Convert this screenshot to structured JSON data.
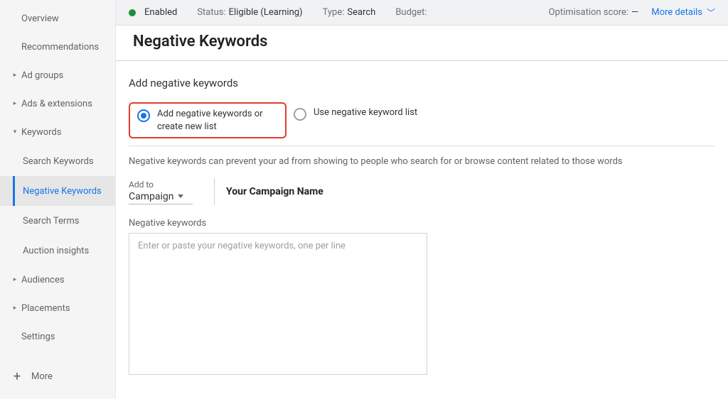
{
  "sidebar": {
    "items": [
      {
        "label": "Overview",
        "expandable": false
      },
      {
        "label": "Recommendations",
        "expandable": false
      },
      {
        "label": "Ad groups",
        "expandable": true,
        "expanded": false
      },
      {
        "label": "Ads & extensions",
        "expandable": true,
        "expanded": false
      },
      {
        "label": "Keywords",
        "expandable": true,
        "expanded": true,
        "children": [
          {
            "label": "Search Keywords",
            "active": false
          },
          {
            "label": "Negative Keywords",
            "active": true
          },
          {
            "label": "Search Terms",
            "active": false
          },
          {
            "label": "Auction insights",
            "active": false
          }
        ]
      },
      {
        "label": "Audiences",
        "expandable": true,
        "expanded": false
      },
      {
        "label": "Placements",
        "expandable": true,
        "expanded": false
      },
      {
        "label": "Settings",
        "expandable": false
      }
    ],
    "more": "More"
  },
  "topbar": {
    "enabled_label": "Enabled",
    "status_label": "Status:",
    "status_value": "Eligible (Learning)",
    "type_label": "Type:",
    "type_value": "Search",
    "budget_label": "Budget:",
    "budget_value": "",
    "opt_label": "Optimisation score:",
    "opt_value": "—",
    "more_details": "More details"
  },
  "page": {
    "title": "Negative Keywords",
    "section_heading": "Add negative keywords",
    "option_a": "Add negative keywords or create new list",
    "option_b": "Use negative keyword list",
    "selected_option": "a",
    "helper_text": "Negative keywords can prevent your ad from showing to people who search for or browse content related to those words",
    "add_to_label": "Add to",
    "add_to_value": "Campaign",
    "campaign_name": "Your Campaign Name",
    "nk_label": "Negative keywords",
    "nk_placeholder": "Enter or paste your negative keywords, one per line",
    "nk_value": ""
  },
  "glyphs": {
    "caret_right": "▸",
    "caret_down": "▾",
    "chevron_down": "﹀",
    "plus": "+"
  }
}
